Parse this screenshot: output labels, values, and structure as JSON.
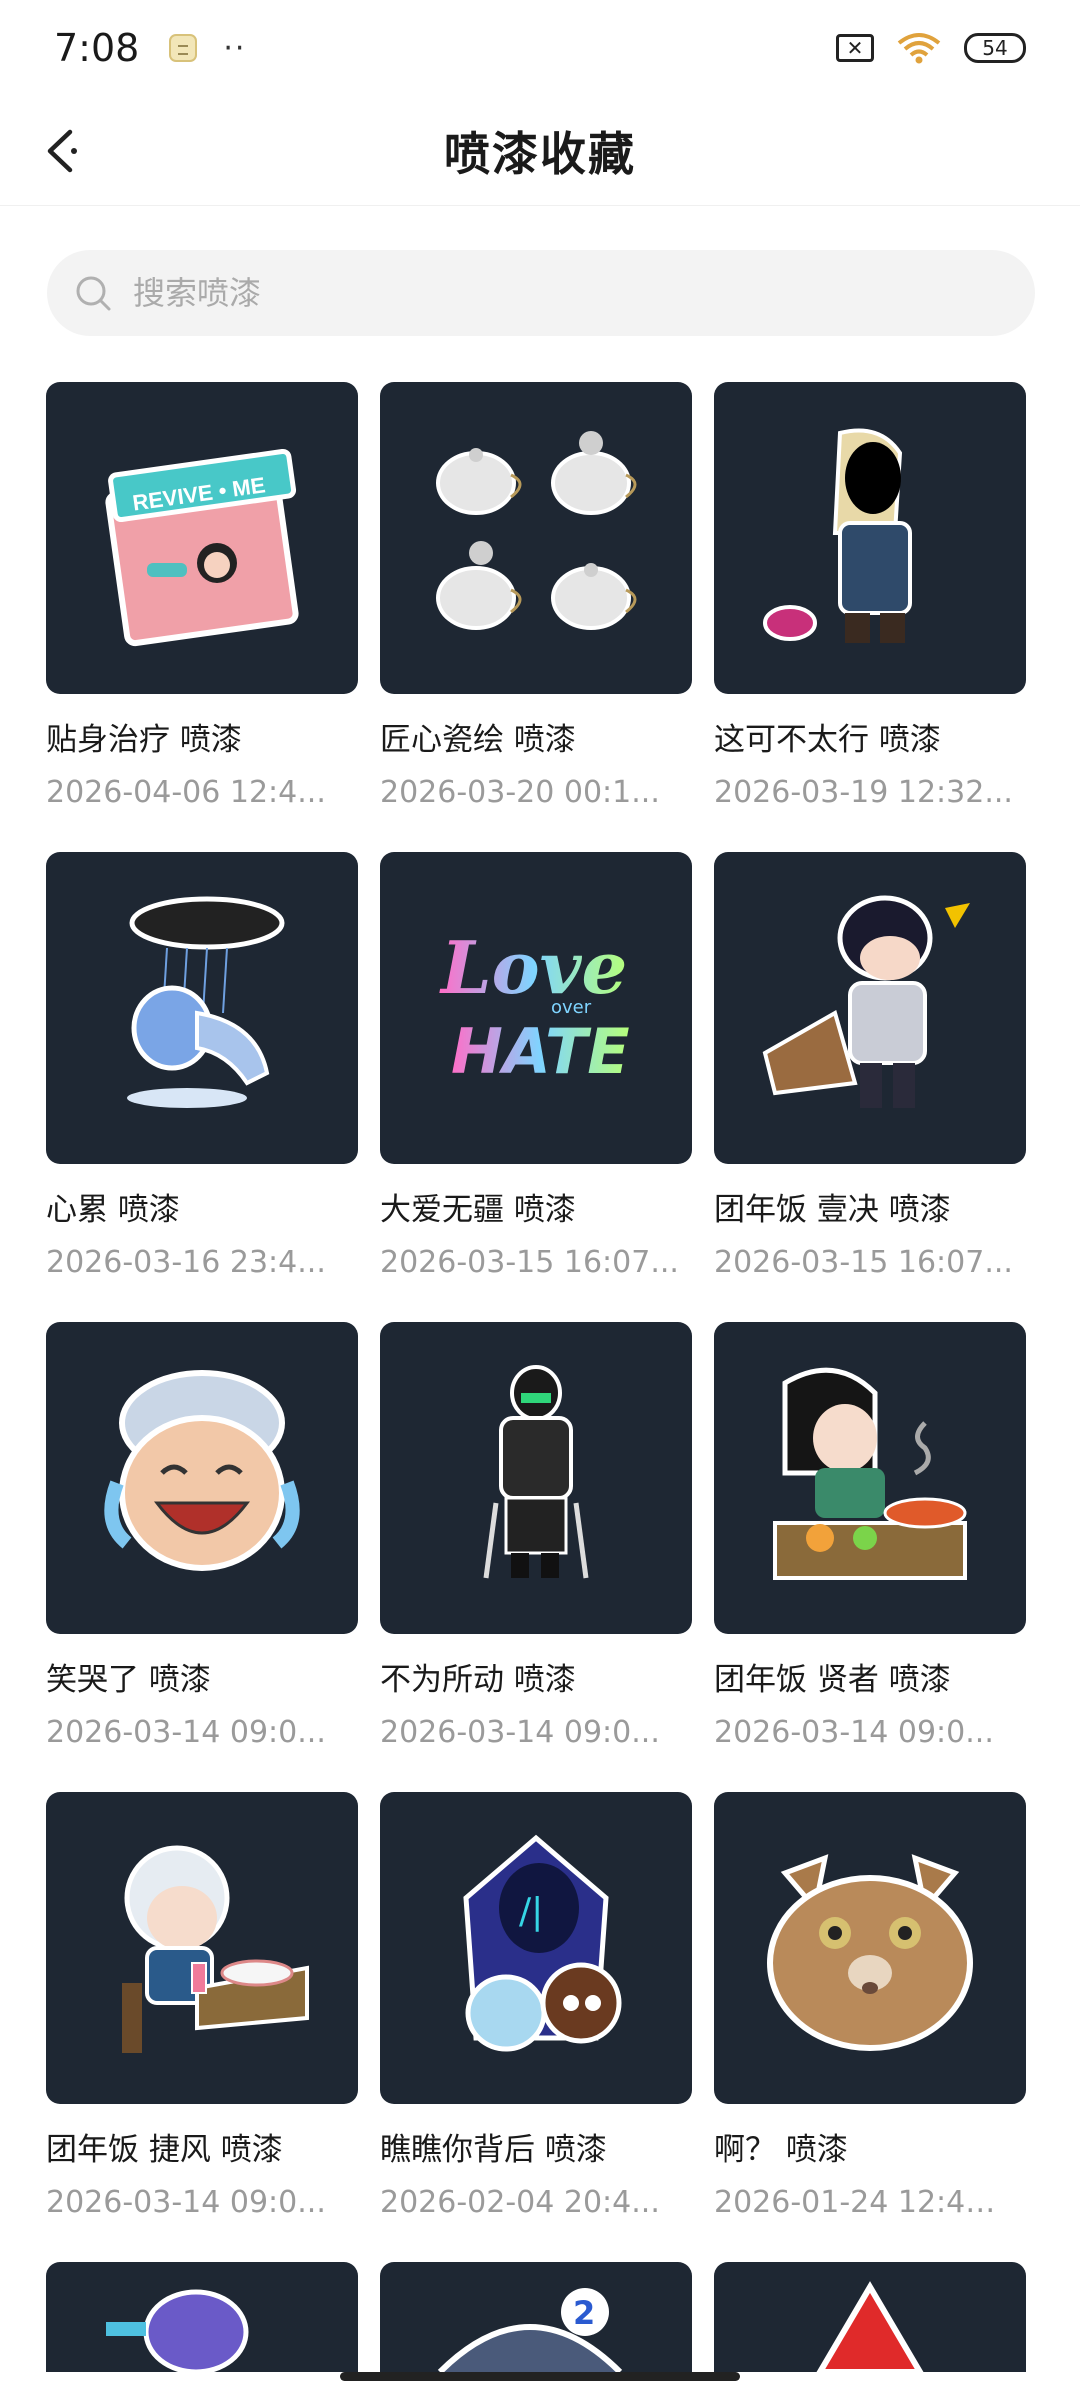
{
  "status": {
    "time": "7:08",
    "dots": "··",
    "battery": "54"
  },
  "header": {
    "title": "喷漆收藏"
  },
  "search": {
    "placeholder": "搜索喷漆"
  },
  "items": [
    {
      "name": "贴身治疗 喷漆",
      "date": "2026-04-06 12:4...",
      "icon": "revive-me-sticker"
    },
    {
      "name": "匠心瓷绘 喷漆",
      "date": "2026-03-20 00:1...",
      "icon": "teapots-sticker"
    },
    {
      "name": "这可不太行 喷漆",
      "date": "2026-03-19 12:32...",
      "icon": "shouting-agent-sticker"
    },
    {
      "name": "心累 喷漆",
      "date": "2026-03-16 23:4...",
      "icon": "rain-cloud-sticker"
    },
    {
      "name": "大爱无疆 喷漆",
      "date": "2026-03-15 16:07...",
      "icon": "love-over-hate-sticker"
    },
    {
      "name": "团年饭 壹决 喷漆",
      "date": "2026-03-15 16:07...",
      "icon": "dinner-agent-sticker"
    },
    {
      "name": "笑哭了 喷漆",
      "date": "2026-03-14 09:0...",
      "icon": "laughing-crying-sticker"
    },
    {
      "name": "不为所动 喷漆",
      "date": "2026-03-14 09:0...",
      "icon": "seated-agent-sticker"
    },
    {
      "name": "团年饭 贤者 喷漆",
      "date": "2026-03-14 09:0...",
      "icon": "sage-dinner-sticker"
    },
    {
      "name": "团年饭 捷风 喷漆",
      "date": "2026-03-14 09:0...",
      "icon": "jett-dinner-sticker"
    },
    {
      "name": "瞧瞧你背后 喷漆",
      "date": "2026-02-04 20:4...",
      "icon": "behind-you-sticker"
    },
    {
      "name": "啊？ 喷漆",
      "date": "2026-01-24 12:41:...",
      "icon": "shocked-cat-sticker"
    }
  ],
  "colors": {
    "tile_bg": "#1e2733",
    "date_text": "#9a9a9a"
  }
}
